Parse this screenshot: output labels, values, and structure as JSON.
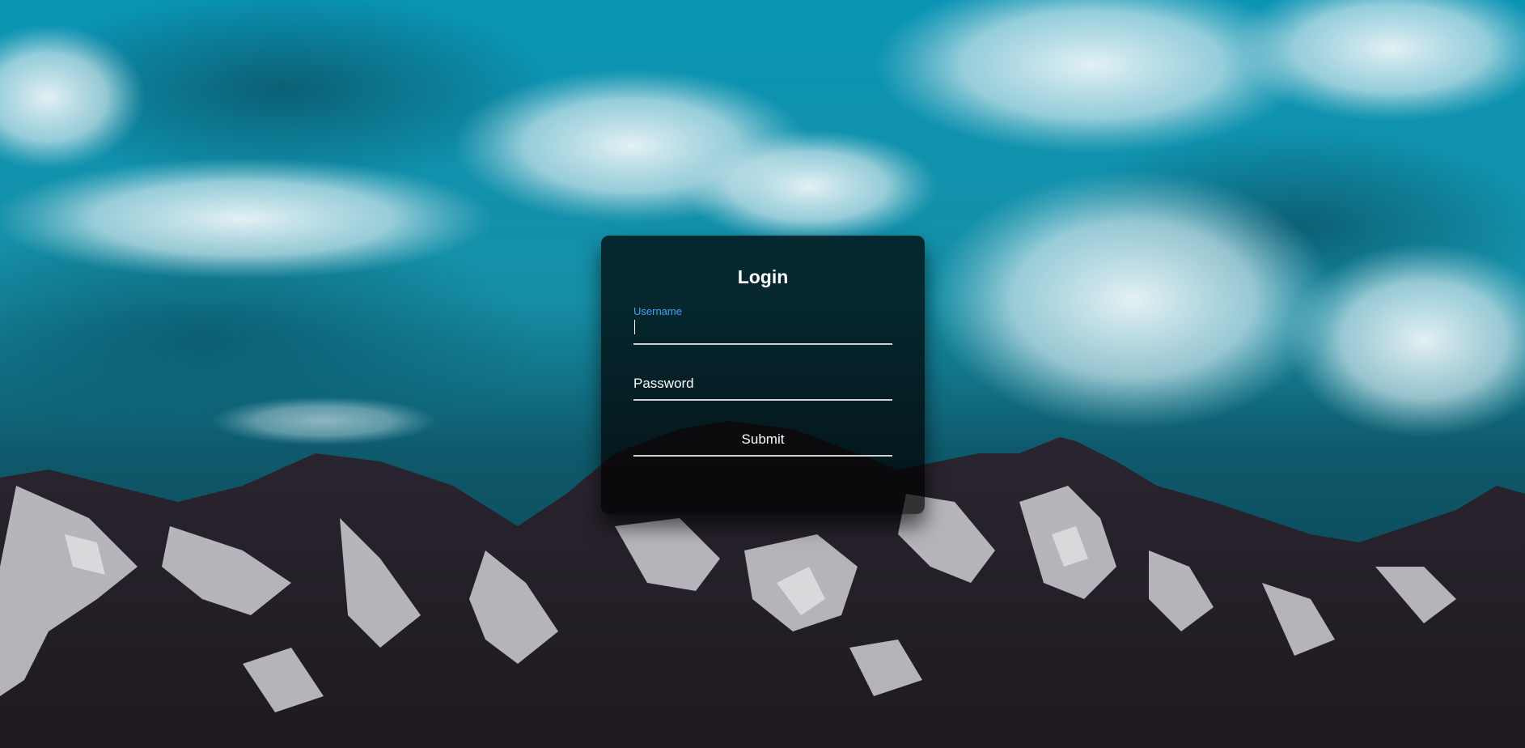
{
  "login": {
    "title": "Login",
    "username_label": "Username",
    "password_label": "Password",
    "submit_label": "Submit"
  },
  "colors": {
    "accent_label": "#3fa4f0",
    "card_background": "rgba(0,0,0,0.72)",
    "sky": "#0a8fae"
  }
}
